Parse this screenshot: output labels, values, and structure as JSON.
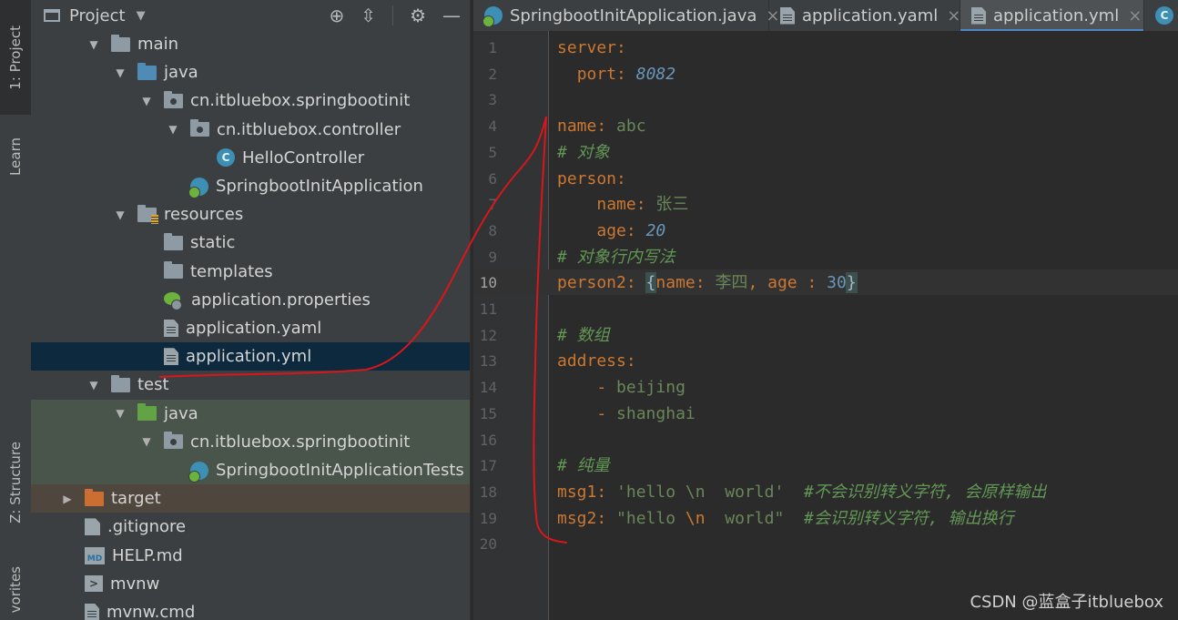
{
  "side_tabs": {
    "project": "1: Project",
    "learn": "Learn",
    "structure": "Z: Structure",
    "favorites": "vorites"
  },
  "project_panel": {
    "title": "Project",
    "tree": [
      {
        "label": "main",
        "type": "folder",
        "depth": 2,
        "expanded": true
      },
      {
        "label": "java",
        "type": "folder-blue",
        "depth": 3,
        "expanded": true
      },
      {
        "label": "cn.itbluebox.springbootinit",
        "type": "package",
        "depth": 4,
        "expanded": true
      },
      {
        "label": "cn.itbluebox.controller",
        "type": "package",
        "depth": 5,
        "expanded": true
      },
      {
        "label": "HelloController",
        "type": "class",
        "depth": 6
      },
      {
        "label": "SpringbootInitApplication",
        "type": "boot",
        "depth": 5
      },
      {
        "label": "resources",
        "type": "resources",
        "depth": 3,
        "expanded": true
      },
      {
        "label": "static",
        "type": "folder",
        "depth": 4
      },
      {
        "label": "templates",
        "type": "folder",
        "depth": 4
      },
      {
        "label": "application.properties",
        "type": "props",
        "depth": 4
      },
      {
        "label": "application.yaml",
        "type": "file",
        "depth": 4
      },
      {
        "label": "application.yml",
        "type": "file",
        "depth": 4,
        "selected": true
      },
      {
        "label": "test",
        "type": "folder",
        "depth": 2,
        "expanded": true
      },
      {
        "label": "java",
        "type": "folder-green",
        "depth": 3,
        "expanded": true,
        "test": true
      },
      {
        "label": "cn.itbluebox.springbootinit",
        "type": "package",
        "depth": 4,
        "expanded": true,
        "test": true
      },
      {
        "label": "SpringbootInitApplicationTests",
        "type": "boot",
        "depth": 5,
        "test": true
      },
      {
        "label": "target",
        "type": "folder-orange",
        "depth": 1,
        "expanded": false,
        "excluded": true
      },
      {
        "label": ".gitignore",
        "type": "git",
        "depth": 1
      },
      {
        "label": "HELP.md",
        "type": "md",
        "depth": 1
      },
      {
        "label": "mvnw",
        "type": "term",
        "depth": 1
      },
      {
        "label": "mvnw.cmd",
        "type": "file",
        "depth": 1
      }
    ]
  },
  "tabs": [
    {
      "label": "SpringbootInitApplication.java",
      "icon": "spring-boot-icon"
    },
    {
      "label": "application.yaml",
      "icon": "file-icon"
    },
    {
      "label": "application.yml",
      "icon": "file-icon",
      "active": true
    },
    {
      "label": "",
      "icon": "class-icon"
    }
  ],
  "editor": {
    "current_line": 10,
    "lines": [
      {
        "n": "1",
        "t": [
          [
            "k",
            "server"
          ],
          [
            "p",
            ":"
          ]
        ]
      },
      {
        "n": "2",
        "t": [
          [
            "txt",
            "  "
          ],
          [
            "k",
            "port"
          ],
          [
            "p",
            ": "
          ],
          [
            "n",
            "8082"
          ]
        ]
      },
      {
        "n": "3",
        "t": []
      },
      {
        "n": "4",
        "t": [
          [
            "k",
            "name"
          ],
          [
            "p",
            ": "
          ],
          [
            "v",
            "abc"
          ]
        ]
      },
      {
        "n": "5",
        "t": [
          [
            "c",
            "# 对象"
          ]
        ]
      },
      {
        "n": "6",
        "t": [
          [
            "k",
            "person"
          ],
          [
            "p",
            ":"
          ]
        ]
      },
      {
        "n": "7",
        "t": [
          [
            "txt",
            "    "
          ],
          [
            "k",
            "name"
          ],
          [
            "p",
            ": "
          ],
          [
            "v",
            "张三"
          ]
        ]
      },
      {
        "n": "8",
        "t": [
          [
            "txt",
            "    "
          ],
          [
            "k",
            "age"
          ],
          [
            "p",
            ": "
          ],
          [
            "n",
            "20"
          ]
        ]
      },
      {
        "n": "9",
        "t": [
          [
            "c",
            "# 对象行内写法"
          ]
        ]
      },
      {
        "n": "10",
        "t": [
          [
            "k",
            "person2"
          ],
          [
            "p",
            ": "
          ],
          [
            "brace",
            "{"
          ],
          [
            "k",
            "name"
          ],
          [
            "p",
            ": "
          ],
          [
            "v",
            "李四"
          ],
          [
            "punc",
            ", "
          ],
          [
            "k",
            "age"
          ],
          [
            "txt",
            " "
          ],
          [
            "p",
            ": "
          ],
          [
            "n2",
            "30"
          ],
          [
            "brace",
            "}"
          ]
        ]
      },
      {
        "n": "11",
        "t": []
      },
      {
        "n": "12",
        "t": [
          [
            "c",
            "# 数组"
          ]
        ]
      },
      {
        "n": "13",
        "t": [
          [
            "k",
            "address"
          ],
          [
            "p",
            ":"
          ]
        ]
      },
      {
        "n": "14",
        "t": [
          [
            "txt",
            "    "
          ],
          [
            "p",
            "- "
          ],
          [
            "v",
            "beijing"
          ]
        ]
      },
      {
        "n": "15",
        "t": [
          [
            "txt",
            "    "
          ],
          [
            "p",
            "- "
          ],
          [
            "v",
            "shanghai"
          ]
        ]
      },
      {
        "n": "16",
        "t": []
      },
      {
        "n": "17",
        "t": [
          [
            "c",
            "# 纯量"
          ]
        ]
      },
      {
        "n": "18",
        "t": [
          [
            "k",
            "msg1"
          ],
          [
            "p",
            ": "
          ],
          [
            "s",
            "'hello \\n  world'"
          ],
          [
            "txt",
            "  "
          ],
          [
            "c",
            "#不会识别转义字符, 会原样输出"
          ]
        ]
      },
      {
        "n": "19",
        "t": [
          [
            "k",
            "msg2"
          ],
          [
            "p",
            ": "
          ],
          [
            "s",
            "\"hello "
          ],
          [
            "esc",
            "\\n"
          ],
          [
            "s",
            "  world\""
          ],
          [
            "txt",
            "  "
          ],
          [
            "c",
            "#会识别转义字符, 输出换行"
          ]
        ]
      },
      {
        "n": "20",
        "t": []
      }
    ]
  },
  "watermark": "CSDN @蓝盒子itbluebox",
  "colors": {
    "annotation_stroke": "#d8161b",
    "selection": "#0d293e",
    "tab_accent": "#4a88c7"
  }
}
